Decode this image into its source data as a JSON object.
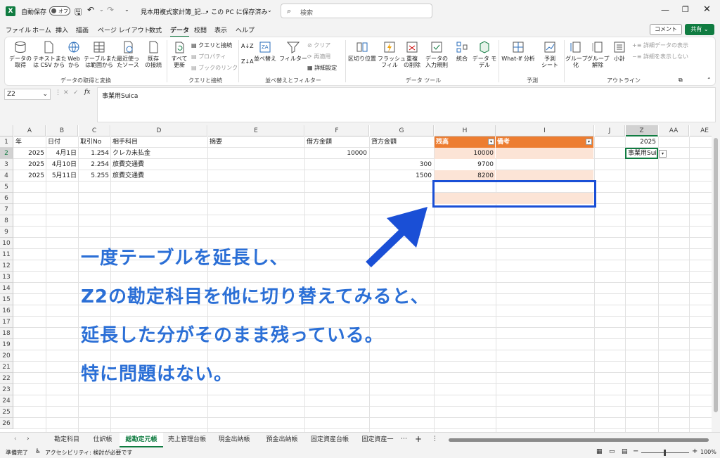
{
  "titlebar": {
    "autosave_label": "自動保存",
    "autosave_state": "オフ",
    "filename": "見本用複式家計簿_記…",
    "save_status": "• この PC に保存済み",
    "search_placeholder": "検索"
  },
  "menu": [
    "ファイル",
    "ホーム",
    "挿入",
    "描画",
    "ページ レイアウト",
    "数式",
    "データ",
    "校閲",
    "表示",
    "ヘルプ"
  ],
  "menu_active": "データ",
  "comment_button": "コメント",
  "share_button": "共有",
  "ribbon": {
    "get_data": "データの\n取得",
    "from_text": "テキストまた\nは CSV から",
    "from_web": "Web\nから",
    "from_table": "テーブルまた\nは範囲から",
    "recent": "最近使っ\nたソース",
    "existing": "既存\nの接続",
    "group1": "データの取得と変換",
    "refresh_all": "すべて\n更新",
    "queries": "クエリと接続",
    "properties": "プロパティ",
    "edit_links": "ブックのリンク",
    "group2": "クエリと接続",
    "sort": "並べ替え",
    "filter": "フィルター",
    "clear": "クリア",
    "reapply": "再適用",
    "advanced": "詳細設定",
    "group3": "並べ替えとフィルター",
    "text_to_cols": "区切り位置",
    "flash_fill": "フラッシュ\nフィル",
    "remove_dup": "重複\nの削除",
    "validation": "データの\n入力規則",
    "consolidate": "統合",
    "data_model": "データ モ\nデル",
    "group4": "データ ツール",
    "what_if": "What-If 分析",
    "forecast": "予測\nシート",
    "group5": "予測",
    "group_btn": "グループ\n化",
    "ungroup_btn": "グループ\n解除",
    "subtotal": "小計",
    "show_detail": "詳細データの表示",
    "hide_detail": "詳細を表示しない",
    "group6": "アウトライン"
  },
  "formula_bar": {
    "name_box": "Z2",
    "fx": "fx",
    "content": "事業用Suica"
  },
  "columns": [
    "A",
    "B",
    "C",
    "D",
    "E",
    "F",
    "G",
    "H",
    "I",
    "J",
    "Z",
    "AA",
    "AE"
  ],
  "header_row": [
    "年",
    "日付",
    "取引No",
    "相手科目",
    "摘要",
    "借方金額",
    "貸方金額",
    "残高",
    "備考"
  ],
  "rows": [
    {
      "year": "2025",
      "date": "4月1日",
      "no": "1.254",
      "account": "クレカ未払金",
      "debit": "10000",
      "credit": "",
      "balance": "10000"
    },
    {
      "year": "2025",
      "date": "4月10日",
      "no": "2.254",
      "account": "旅費交通費",
      "debit": "",
      "credit": "300",
      "balance": "9700"
    },
    {
      "year": "2025",
      "date": "5月11日",
      "no": "5.255",
      "account": "旅費交通費",
      "debit": "",
      "credit": "1500",
      "balance": "8200"
    }
  ],
  "z_column": {
    "z1": "2025",
    "z2": "事業用Sui"
  },
  "annotation": [
    "一度テーブルを延長し、",
    "Z2の勘定科目を他に切り替えてみると、",
    "延長した分がそのまま残っている。",
    "特に問題はない。"
  ],
  "sheets": [
    "勘定科目",
    "仕訳帳",
    "総勘定元帳",
    "売上管理台帳",
    "現金出納帳",
    "預金出納帳",
    "固定資産台帳",
    "固定資産一"
  ],
  "active_sheet": "総勘定元帳",
  "status": {
    "ready": "準備完了",
    "accessibility": "アクセシビリティ: 検討が必要です",
    "zoom": "100%"
  },
  "colors": {
    "excel_green": "#107c41",
    "table_header": "#ed7d31",
    "table_band": "#fce4d6",
    "annotation": "#2b6fd6",
    "highlight_box": "#1a4fd6"
  }
}
